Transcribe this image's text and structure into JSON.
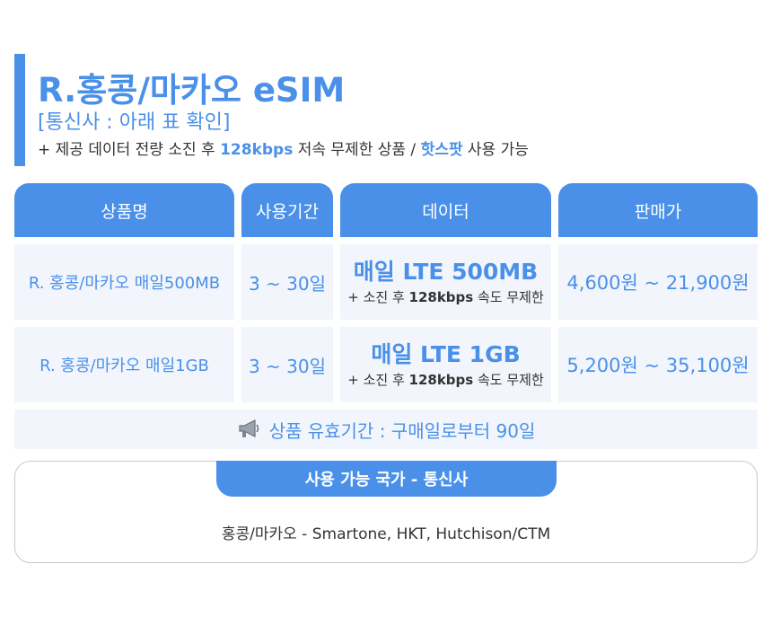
{
  "header": {
    "title": "R.홍콩/마카오 eSIM",
    "carrier_note": "[통신사 : 아래 표 확인]",
    "desc_prefix": "+ 제공 데이터 전량 소진 후 ",
    "desc_speed": "128kbps",
    "desc_middle": " 저속 무제한 상품 / ",
    "desc_hotspot": "핫스팟",
    "desc_suffix": " 사용 가능",
    "accent_color": "#4a90e8"
  },
  "table": {
    "headers": [
      "상품명",
      "사용기간",
      "데이터",
      "판매가"
    ],
    "rows": [
      {
        "name": "R. 홍콩/마카오 매일500MB",
        "period": "3 ~ 30일",
        "data_main": "매일 LTE 500MB",
        "data_sub_prefix": "+ 소진 후 ",
        "data_sub_speed": "128kbps",
        "data_sub_suffix": " 속도 무제한",
        "price": "4,600원 ~ 21,900원"
      },
      {
        "name": "R. 홍콩/마카오 매일1GB",
        "period": "3 ~ 30일",
        "data_main": "매일 LTE 1GB",
        "data_sub_prefix": "+ 소진 후 ",
        "data_sub_speed": "128kbps",
        "data_sub_suffix": " 속도 무제한",
        "price": "5,200원 ~ 35,100원"
      }
    ]
  },
  "validity": {
    "icon": "megaphone-icon",
    "text": "상품 유효기간 : 구매일로부터 90일"
  },
  "countries": {
    "tab_label": "사용 가능 국가 - 통신사",
    "text": "홍콩/마카오 - Smartone, HKT, Hutchison/CTM"
  }
}
